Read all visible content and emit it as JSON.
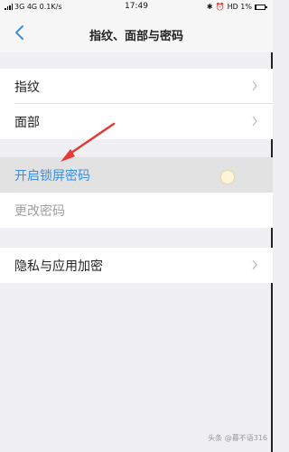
{
  "status_bar": {
    "left_text": "3G 4G 0.1K/s",
    "time": "17:49",
    "right_text": "HD 1%",
    "battery_level": 0.01
  },
  "header": {
    "title": "指纹、面部与密码"
  },
  "groups": [
    {
      "items": [
        {
          "label": "指纹"
        },
        {
          "label": "面部"
        }
      ]
    },
    {
      "items": [
        {
          "label": "开启锁屏密码"
        },
        {
          "label": "更改密码"
        }
      ]
    },
    {
      "items": [
        {
          "label": "隐私与应用加密"
        }
      ]
    }
  ],
  "watermark": "头条 @暮不语316",
  "colors": {
    "link_blue": "#3a8ee6",
    "disabled_gray": "#a0a0a0",
    "arrow_red": "#e53935"
  },
  "icons": [
    "back-icon",
    "chevron-right-icon",
    "battery-icon",
    "signal-icon",
    "bluetooth-icon",
    "alarm-icon"
  ]
}
